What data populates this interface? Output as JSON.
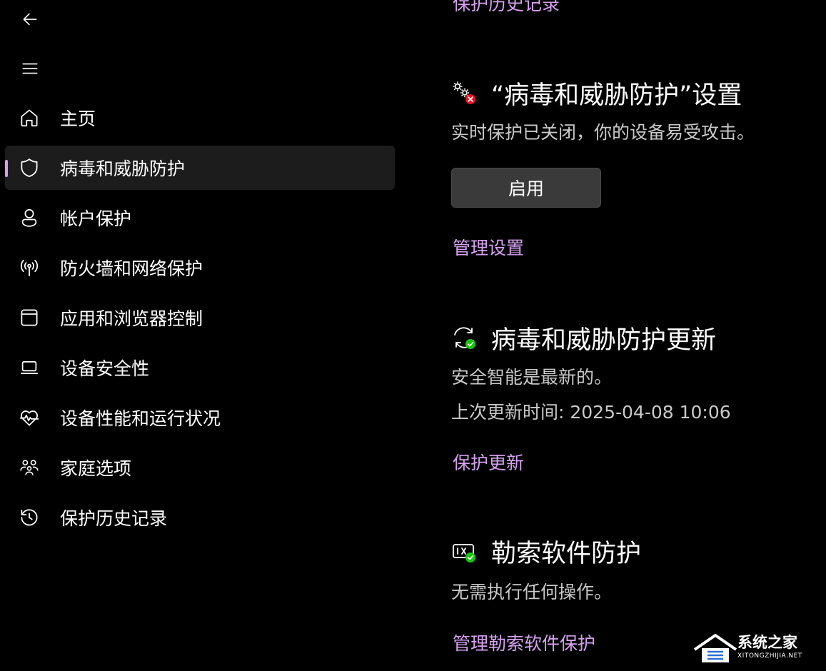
{
  "nav": {
    "back_icon": "back-arrow-icon",
    "menu_icon": "hamburger-menu-icon",
    "items": [
      {
        "label": "主页",
        "icon": "home-icon",
        "active": false
      },
      {
        "label": "病毒和威胁防护",
        "icon": "shield-icon",
        "active": true
      },
      {
        "label": "帐户保护",
        "icon": "person-icon",
        "active": false
      },
      {
        "label": "防火墙和网络保护",
        "icon": "wireless-antenna-icon",
        "active": false
      },
      {
        "label": "应用和浏览器控制",
        "icon": "app-window-icon",
        "active": false
      },
      {
        "label": "设备安全性",
        "icon": "laptop-icon",
        "active": false
      },
      {
        "label": "设备性能和运行状况",
        "icon": "heart-pulse-icon",
        "active": false
      },
      {
        "label": "家庭选项",
        "icon": "family-icon",
        "active": false
      },
      {
        "label": "保护历史记录",
        "icon": "history-icon",
        "active": false
      }
    ]
  },
  "main": {
    "top_link": "保护历史记录",
    "settings": {
      "title": "“病毒和威胁防护”设置",
      "icon": "settings-gears-error-icon",
      "status": "实时保护已关闭，你的设备易受攻击。",
      "button_label": "启用",
      "link": "管理设置"
    },
    "updates": {
      "title": "病毒和威胁防护更新",
      "icon": "sync-check-icon",
      "status": "安全智能是最新的。",
      "last_update": "上次更新时间: 2025-04-08 10:06",
      "link": "保护更新"
    },
    "ransomware": {
      "title": "勒索软件防护",
      "icon": "ransomware-check-icon",
      "status": "无需执行任何操作。",
      "link": "管理勒索软件保护"
    }
  },
  "watermark": {
    "text": "系统之家",
    "sub": "XITONGZHIJIA.NET"
  },
  "colors": {
    "background": "#000000",
    "accent": "#d6a1f0",
    "error": "#e81123",
    "success": "#16c60c",
    "button": "#3a3a3a"
  }
}
